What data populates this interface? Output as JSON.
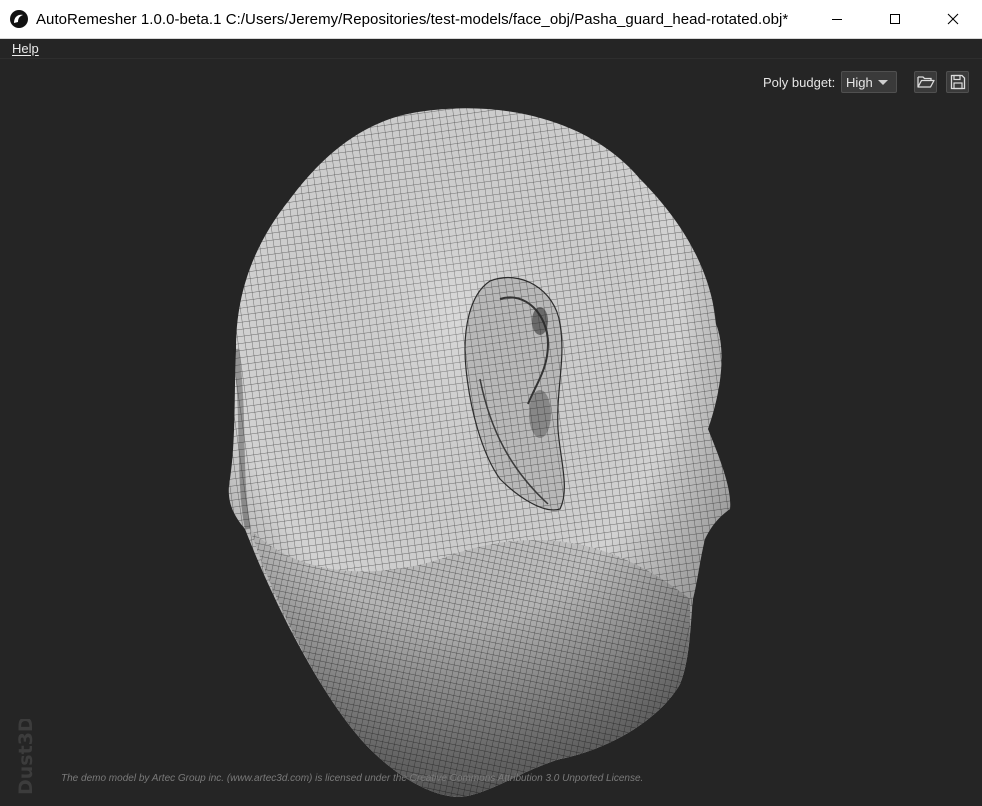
{
  "window": {
    "title": "AutoRemesher 1.0.0-beta.1 C:/Users/Jeremy/Repositories/test-models/face_obj/Pasha_guard_head-rotated.obj*",
    "app_icon": "autoremesher-logo-icon",
    "controls": {
      "minimize_icon": "minimize-icon",
      "maximize_icon": "maximize-icon",
      "close_icon": "close-icon"
    }
  },
  "menubar": {
    "items": [
      {
        "label": "Help",
        "mnemonic": "H"
      }
    ]
  },
  "toolbar": {
    "poly_budget_label": "Poly budget:",
    "poly_budget_value": "High",
    "open_icon": "folder-open-icon",
    "save_icon": "save-icon"
  },
  "viewport": {
    "model": "remeshed quad-mesh head, rear-three-quarter view",
    "watermark": "Dust3D",
    "license_text": "The demo model by Artec Group inc. (www.artec3d.com) is licensed under the Creative Commons Attribution 3.0 Unported License."
  },
  "colors": {
    "background": "#252525",
    "titlebar": "#ffffff",
    "mesh_surface": "#d4d4d4",
    "mesh_lines": "#3a3a3a"
  }
}
